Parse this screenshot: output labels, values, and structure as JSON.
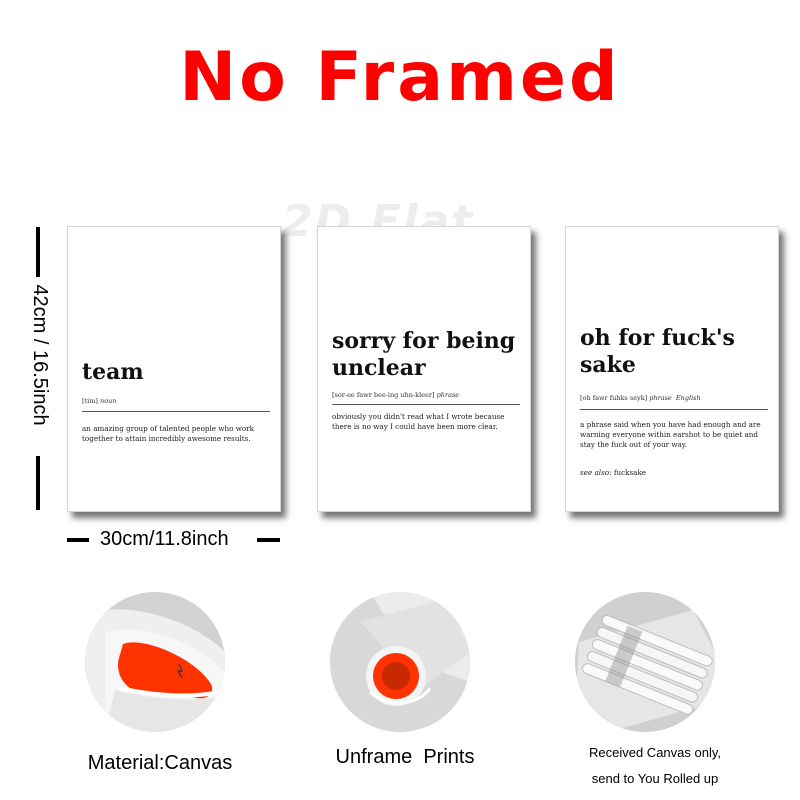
{
  "headline": "No Framed",
  "watermark": "2D Flat",
  "dimensions": {
    "height_label": "42cm / 16.5inch",
    "width_label": "30cm/11.8inch"
  },
  "posters": [
    {
      "word": "team",
      "pronunciation": "[tim]",
      "part_of_speech": "noun",
      "definition": "an amazing group of talented people who work together to attain incredibly awesome results."
    },
    {
      "word": "sorry for being unclear",
      "pronunciation": "[sor-ee fawr bee-ing uhn-kleer]",
      "part_of_speech": "phrase",
      "definition": "obviously you didn't read what I wrote because there is no way I could have been more clear."
    },
    {
      "word": "oh for fuck's sake",
      "pronunciation": "[oh fawr fuhks seyk]",
      "part_of_speech": "phrase",
      "language": "English",
      "definition": "a phrase said when you have had enough and are warning everyone within earshot to be quiet and stay the fuck out of your way.",
      "see_also_label": "see also:",
      "see_also_value": "fucksake"
    }
  ],
  "features": [
    {
      "caption": "Material:Canvas"
    },
    {
      "caption": "Unframe  Prints"
    },
    {
      "caption_line1": "Received Canvas only,",
      "caption_line2": "send to You Rolled up"
    }
  ],
  "colors": {
    "headline": "#ff0000",
    "canvas_inner": "#ff3300"
  }
}
